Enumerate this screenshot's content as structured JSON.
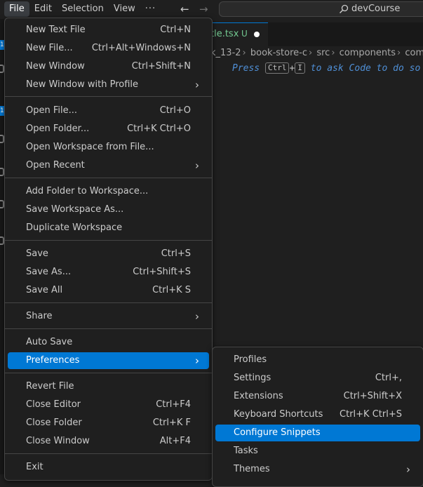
{
  "menubar": {
    "file": "File",
    "edit": "Edit",
    "selection": "Selection",
    "view": "View",
    "more": "···"
  },
  "nav": {
    "back": "←",
    "forward": "→"
  },
  "search": {
    "text": "devCourse",
    "icon": "search-icon"
  },
  "activity": {
    "badge_1": "1",
    "badge_2": "1"
  },
  "editor": {
    "tab_name": "tle.tsx",
    "tab_status": "U",
    "breadcrumb": [
      "k_13-2",
      "book-store-c",
      "src",
      "components",
      "common"
    ],
    "hint": {
      "pre": "Press",
      "key1": "Ctrl",
      "plus": "+",
      "key2": "I",
      "post": "to ask Code to do so"
    }
  },
  "file_menu": {
    "new_text_file": {
      "label": "New Text File",
      "key": "Ctrl+N"
    },
    "new_file": {
      "label": "New File...",
      "key": "Ctrl+Alt+Windows+N"
    },
    "new_window": {
      "label": "New Window",
      "key": "Ctrl+Shift+N"
    },
    "new_window_profile": {
      "label": "New Window with Profile"
    },
    "open_file": {
      "label": "Open File...",
      "key": "Ctrl+O"
    },
    "open_folder": {
      "label": "Open Folder...",
      "key": "Ctrl+K Ctrl+O"
    },
    "open_workspace": {
      "label": "Open Workspace from File..."
    },
    "open_recent": {
      "label": "Open Recent"
    },
    "add_folder": {
      "label": "Add Folder to Workspace..."
    },
    "save_workspace_as": {
      "label": "Save Workspace As..."
    },
    "duplicate_workspace": {
      "label": "Duplicate Workspace"
    },
    "save": {
      "label": "Save",
      "key": "Ctrl+S"
    },
    "save_as": {
      "label": "Save As...",
      "key": "Ctrl+Shift+S"
    },
    "save_all": {
      "label": "Save All",
      "key": "Ctrl+K S"
    },
    "share": {
      "label": "Share"
    },
    "auto_save": {
      "label": "Auto Save"
    },
    "preferences": {
      "label": "Preferences"
    },
    "revert_file": {
      "label": "Revert File"
    },
    "close_editor": {
      "label": "Close Editor",
      "key": "Ctrl+F4"
    },
    "close_folder": {
      "label": "Close Folder",
      "key": "Ctrl+K F"
    },
    "close_window": {
      "label": "Close Window",
      "key": "Alt+F4"
    },
    "exit": {
      "label": "Exit"
    }
  },
  "preferences_menu": {
    "profiles": {
      "label": "Profiles"
    },
    "settings": {
      "label": "Settings",
      "key": "Ctrl+,"
    },
    "extensions": {
      "label": "Extensions",
      "key": "Ctrl+Shift+X"
    },
    "keyboard_shortcuts": {
      "label": "Keyboard Shortcuts",
      "key": "Ctrl+K Ctrl+S"
    },
    "configure_snippets": {
      "label": "Configure Snippets"
    },
    "tasks": {
      "label": "Tasks"
    },
    "themes": {
      "label": "Themes"
    }
  },
  "colors": {
    "accent": "#0078d4",
    "menu_bg": "#1f1f1f",
    "untracked": "#73c991"
  }
}
